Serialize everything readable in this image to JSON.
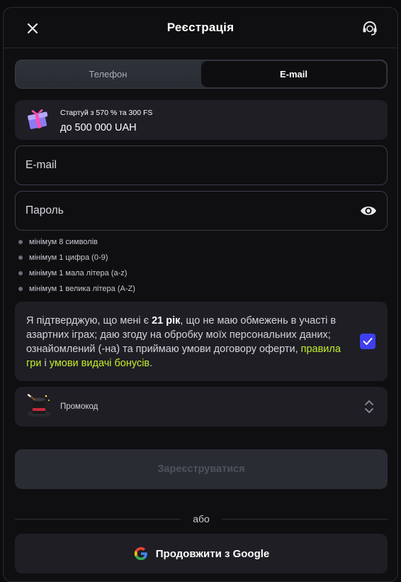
{
  "header": {
    "title": "Реєстрація",
    "close_icon": "close-icon",
    "support_icon": "headset-support-icon"
  },
  "tabs": [
    {
      "label": "Телефон",
      "active": false
    },
    {
      "label": "E-mail",
      "active": true
    }
  ],
  "bonus": {
    "line1": "Стартуй з 570 % та 300 FS",
    "line2": "до 500 000 UAH",
    "icon": "gift-icon"
  },
  "form": {
    "email_placeholder": "E-mail",
    "password_placeholder": "Пароль",
    "password_toggle_icon": "eye-icon"
  },
  "password_rules": [
    "мінімум 8 символів",
    "мінімум 1 цифра (0-9)",
    "мінімум 1 мала літера (a-z)",
    "мінімум 1 велика літера (A-Z)"
  ],
  "consent": {
    "text_before": "Я підтверджую, що мені є ",
    "age": "21 рік",
    "text_middle": ", що не маю обмежень в участі в азартних іграх; даю згоду на обробку моїх персональних даних; ознайомлений (-на) та приймаю умови договору оферти, ",
    "link_rules": "правила гри",
    "and": " і ",
    "link_bonus": "умови видачі бонусів",
    "end": ".",
    "checked": true,
    "link_color": "#c4ee2d",
    "checkbox_color": "#3f3ff0"
  },
  "promo": {
    "label": "Промокод",
    "icon": "magic-hat-icon"
  },
  "submit": {
    "label": "Зареєструватися"
  },
  "divider": {
    "label": "або"
  },
  "google": {
    "label": "Продовжити з Google",
    "icon": "google-icon"
  }
}
